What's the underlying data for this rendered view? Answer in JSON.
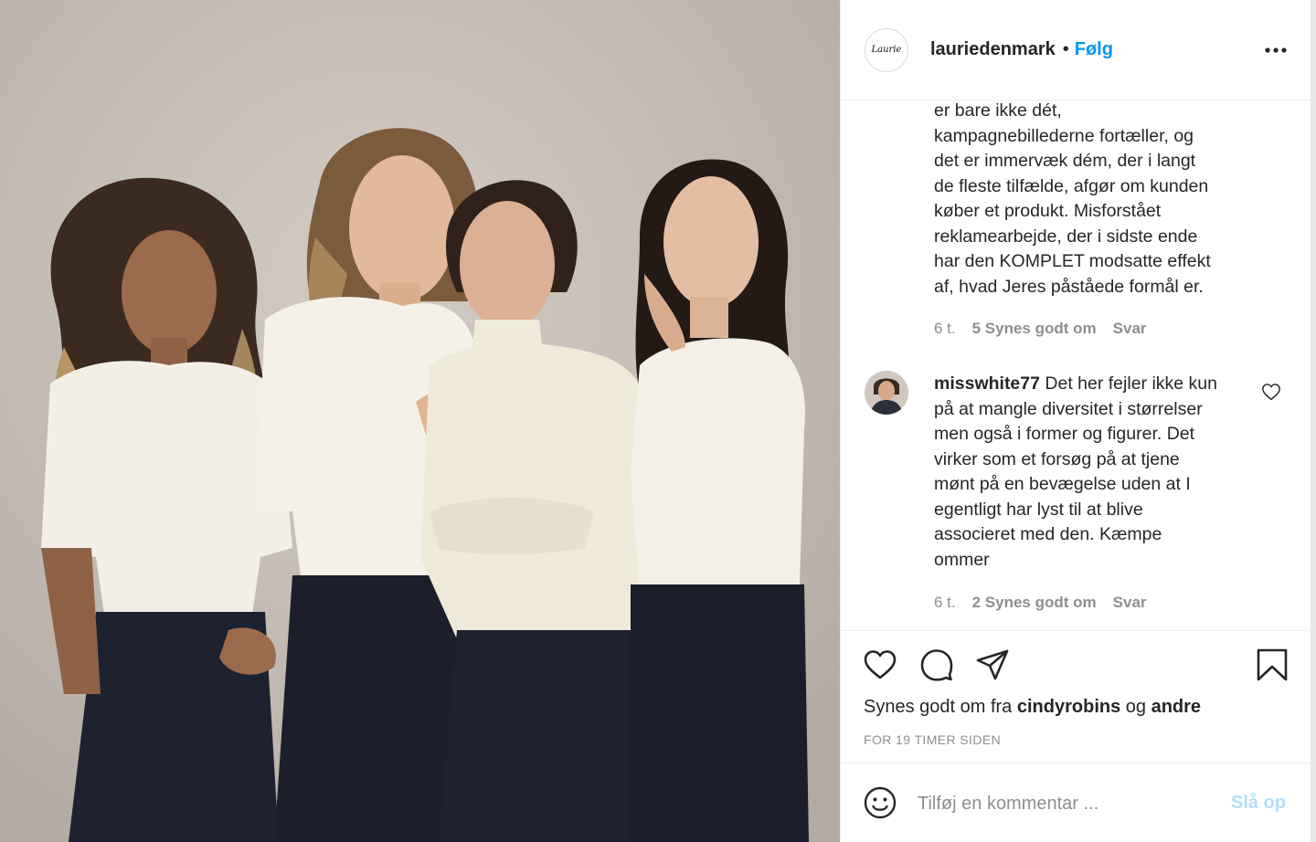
{
  "post": {
    "username": "lauriedenmark",
    "separator": "•",
    "follow_label": "Følg",
    "avatar_text": "Laurie"
  },
  "comments": [
    {
      "text_lines": [
        "er bare ikke dét,",
        "kampagnebillederne fortæller, og",
        "det er immervæk dém, der i langt",
        "de fleste tilfælde, afgør om kunden",
        "køber et produkt. Misforstået",
        "reklamearbejde, der i sidste ende",
        "har den KOMPLET modsatte effekt",
        "af, hvad Jeres påståede formål er."
      ],
      "time": "6 t.",
      "likes": "5 Synes godt om",
      "reply": "Svar"
    },
    {
      "username": "misswhite77",
      "first_line_rest": " Det her fejler ikke kun",
      "text_lines": [
        "på at mangle diversitet i størrelser",
        "men også i former og figurer. Det",
        "virker som et forsøg på at tjene",
        "mønt på en bevægelse uden at I",
        "egentligt har lyst til at blive",
        "associeret med den. Kæmpe",
        "ommer"
      ],
      "time": "6 t.",
      "likes": "2 Synes godt om",
      "reply": "Svar"
    }
  ],
  "actions": {
    "likes_prefix": "Synes godt om fra ",
    "likes_user": "cindyrobins",
    "likes_middle": " og ",
    "likes_others": "andre",
    "timestamp": "FOR 19 TIMER SIDEN"
  },
  "add_comment": {
    "placeholder": "Tilføj en kommentar ...",
    "post_label": "Slå op"
  },
  "icons": {
    "more": "more-horizontal-icon",
    "like": "heart-icon",
    "comment": "comment-bubble-icon",
    "share": "paper-plane-icon",
    "save": "bookmark-icon",
    "emoji": "smiley-icon"
  },
  "colors": {
    "link_blue": "#0095f6",
    "post_disabled": "#b2dffc",
    "meta_grey": "#8e8e8e",
    "text": "#262626",
    "photo_background": "#c3bbb3"
  }
}
